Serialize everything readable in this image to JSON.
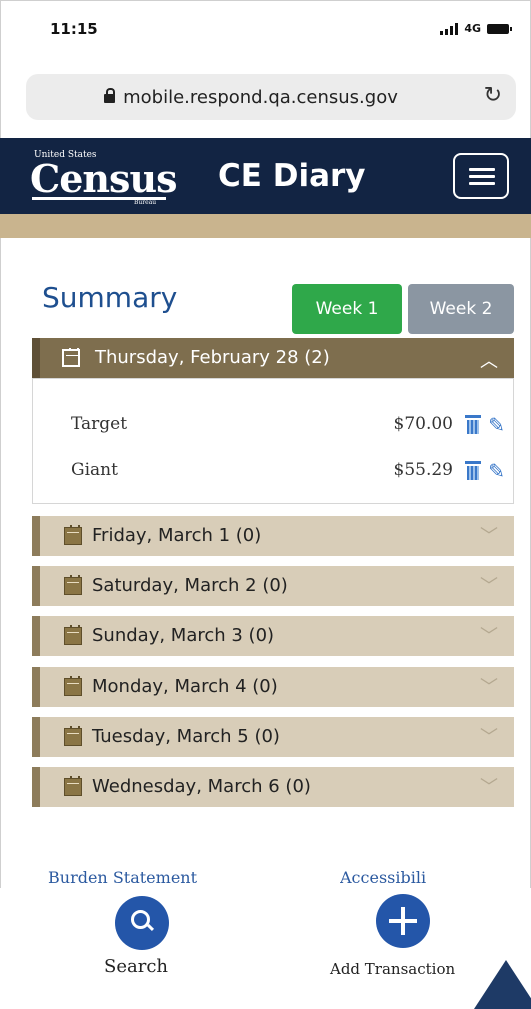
{
  "status_bar": {
    "time": "11:15",
    "network": "4G"
  },
  "browser": {
    "url": "mobile.respond.qa.census.gov"
  },
  "header": {
    "logo_top": "United States",
    "logo_main": "Census",
    "logo_bottom": "Bureau",
    "app_title": "CE Diary"
  },
  "summary": {
    "title": "Summary",
    "week1_label": "Week 1",
    "week2_label": "Week 2",
    "active_week": "Week 1",
    "colors": {
      "week_active": "#2fa84a",
      "week_inactive": "#8b96a2",
      "header": "#122443",
      "accent_link": "#2c5aa0"
    }
  },
  "days": [
    {
      "label": "Thursday, February 28 (2)",
      "expanded": true
    },
    {
      "label": "Friday, March 1 (0)",
      "expanded": false
    },
    {
      "label": "Saturday, March 2 (0)",
      "expanded": false
    },
    {
      "label": "Sunday, March 3 (0)",
      "expanded": false
    },
    {
      "label": "Monday, March 4 (0)",
      "expanded": false
    },
    {
      "label": "Tuesday, March 5 (0)",
      "expanded": false
    },
    {
      "label": "Wednesday, March 6 (0)",
      "expanded": false
    }
  ],
  "transactions": [
    {
      "name": "Target",
      "amount": "$70.00"
    },
    {
      "name": "Giant",
      "amount": "$55.29"
    }
  ],
  "footer": {
    "burden_link": "Burden Statement",
    "accessibility_link": "Accessibili"
  },
  "bottom_nav": {
    "search_label": "Search",
    "add_label": "Add Transaction"
  }
}
